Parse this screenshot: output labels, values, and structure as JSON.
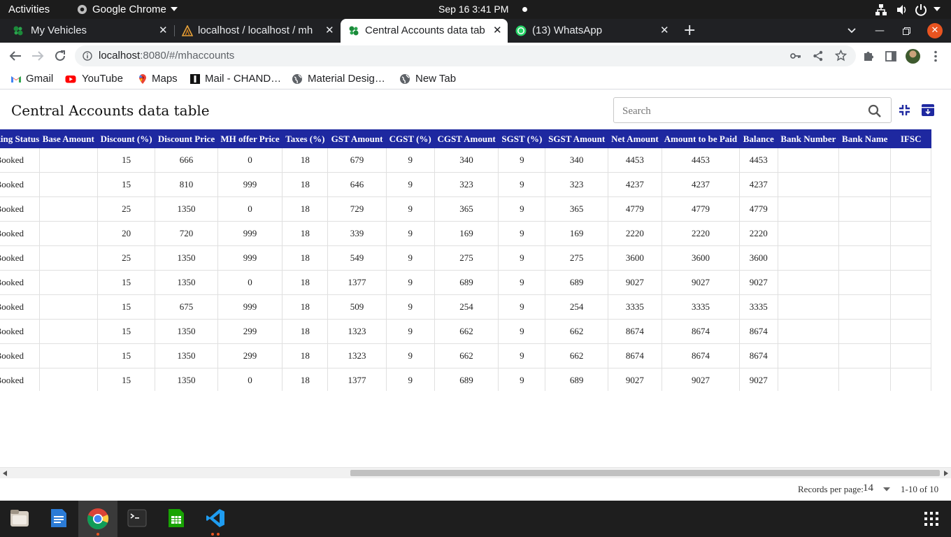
{
  "system": {
    "activities": "Activities",
    "app_name": "Google Chrome",
    "clock": "Sep 16  3:41 PM"
  },
  "tabs": [
    {
      "label": "My Vehicles",
      "icon": "vehicle-favicon-icon",
      "active": false
    },
    {
      "label": "localhost / localhost / mh",
      "icon": "phpmyadmin-favicon-icon",
      "active": false
    },
    {
      "label": "Central Accounts data tab",
      "icon": "vehicle-favicon-icon",
      "active": true
    },
    {
      "label": "(13) WhatsApp",
      "icon": "whatsapp-favicon-icon",
      "active": false
    }
  ],
  "address": {
    "host": "localhost",
    "path": ":8080/#/mhaccounts"
  },
  "bookmarks": [
    {
      "label": "Gmail",
      "icon": "gmail-icon"
    },
    {
      "label": "YouTube",
      "icon": "youtube-icon"
    },
    {
      "label": "Maps",
      "icon": "maps-icon"
    },
    {
      "label": "Mail - CHAND…",
      "icon": "mail-icon"
    },
    {
      "label": "Material Desig…",
      "icon": "globe-icon"
    },
    {
      "label": "New Tab",
      "icon": "globe-icon"
    }
  ],
  "page": {
    "title": "Central Accounts data table",
    "search_placeholder": "Search"
  },
  "table": {
    "columns": [
      "Booking Status",
      "Base Amount",
      "Discount (%)",
      "Discount Price",
      "MH offer Price",
      "Taxes (%)",
      "GST Amount",
      "CGST (%)",
      "CGST Amount",
      "SGST (%)",
      "SGST Amount",
      "Net Amount",
      "Amount to be Paid",
      "Balance",
      "Bank Number",
      "Bank Name",
      "IFSC"
    ],
    "rows": [
      [
        "Booked",
        "",
        "15",
        "666",
        "0",
        "18",
        "679",
        "9",
        "340",
        "9",
        "340",
        "4453",
        "4453",
        "4453",
        "",
        "",
        ""
      ],
      [
        "Booked",
        "",
        "15",
        "810",
        "999",
        "18",
        "646",
        "9",
        "323",
        "9",
        "323",
        "4237",
        "4237",
        "4237",
        "",
        "",
        ""
      ],
      [
        "Booked",
        "",
        "25",
        "1350",
        "0",
        "18",
        "729",
        "9",
        "365",
        "9",
        "365",
        "4779",
        "4779",
        "4779",
        "",
        "",
        ""
      ],
      [
        "Booked",
        "",
        "20",
        "720",
        "999",
        "18",
        "339",
        "9",
        "169",
        "9",
        "169",
        "2220",
        "2220",
        "2220",
        "",
        "",
        ""
      ],
      [
        "Booked",
        "",
        "25",
        "1350",
        "999",
        "18",
        "549",
        "9",
        "275",
        "9",
        "275",
        "3600",
        "3600",
        "3600",
        "",
        "",
        ""
      ],
      [
        "Booked",
        "",
        "15",
        "1350",
        "0",
        "18",
        "1377",
        "9",
        "689",
        "9",
        "689",
        "9027",
        "9027",
        "9027",
        "",
        "",
        ""
      ],
      [
        "Booked",
        "",
        "15",
        "675",
        "999",
        "18",
        "509",
        "9",
        "254",
        "9",
        "254",
        "3335",
        "3335",
        "3335",
        "",
        "",
        ""
      ],
      [
        "Booked",
        "",
        "15",
        "1350",
        "299",
        "18",
        "1323",
        "9",
        "662",
        "9",
        "662",
        "8674",
        "8674",
        "8674",
        "",
        "",
        ""
      ],
      [
        "Booked",
        "",
        "15",
        "1350",
        "299",
        "18",
        "1323",
        "9",
        "662",
        "9",
        "662",
        "8674",
        "8674",
        "8674",
        "",
        "",
        ""
      ],
      [
        "Booked",
        "",
        "15",
        "1350",
        "0",
        "18",
        "1377",
        "9",
        "689",
        "9",
        "689",
        "9027",
        "9027",
        "9027",
        "",
        "",
        ""
      ]
    ]
  },
  "footer": {
    "records_label": "Records per page:",
    "records_value": "14",
    "range": "1-10 of 10"
  },
  "colors": {
    "header_bg": "#1e28a0",
    "accent": "#1e28a0"
  }
}
